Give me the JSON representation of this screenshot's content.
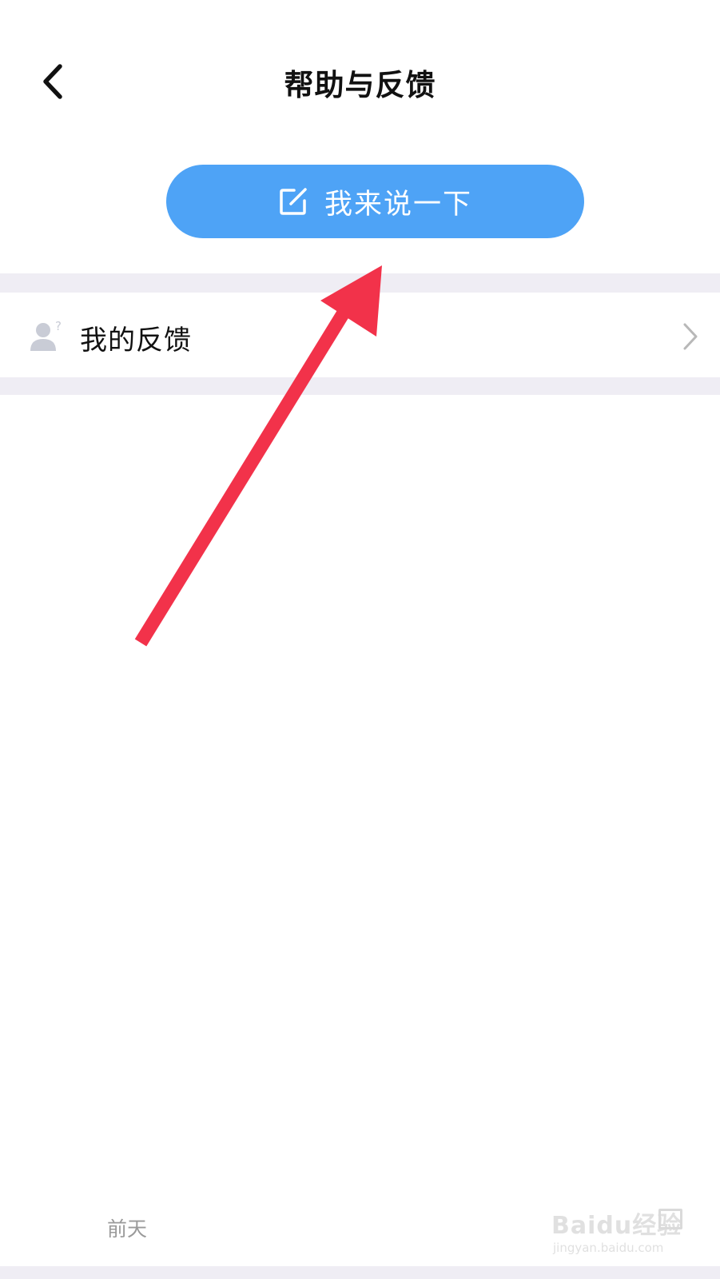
{
  "nav": {
    "title": "帮助与反馈",
    "back_icon": "chevron-left-icon"
  },
  "cta": {
    "label": "我来说一下",
    "icon": "edit-icon",
    "color": "#4ea3f6"
  },
  "list": {
    "items": [
      {
        "label": "我的反馈",
        "icon": "user-question-icon",
        "trailing_icon": "chevron-right-icon"
      }
    ]
  },
  "footer": {
    "date_label": "前天"
  },
  "watermark": {
    "brand": "Baidu经验",
    "url": "jingyan.baidu.com"
  },
  "annotation": {
    "arrow_color": "#f2324a"
  },
  "colors": {
    "section_gap": "#efedf4",
    "text_primary": "#111111",
    "text_secondary": "#9a9a9a"
  }
}
